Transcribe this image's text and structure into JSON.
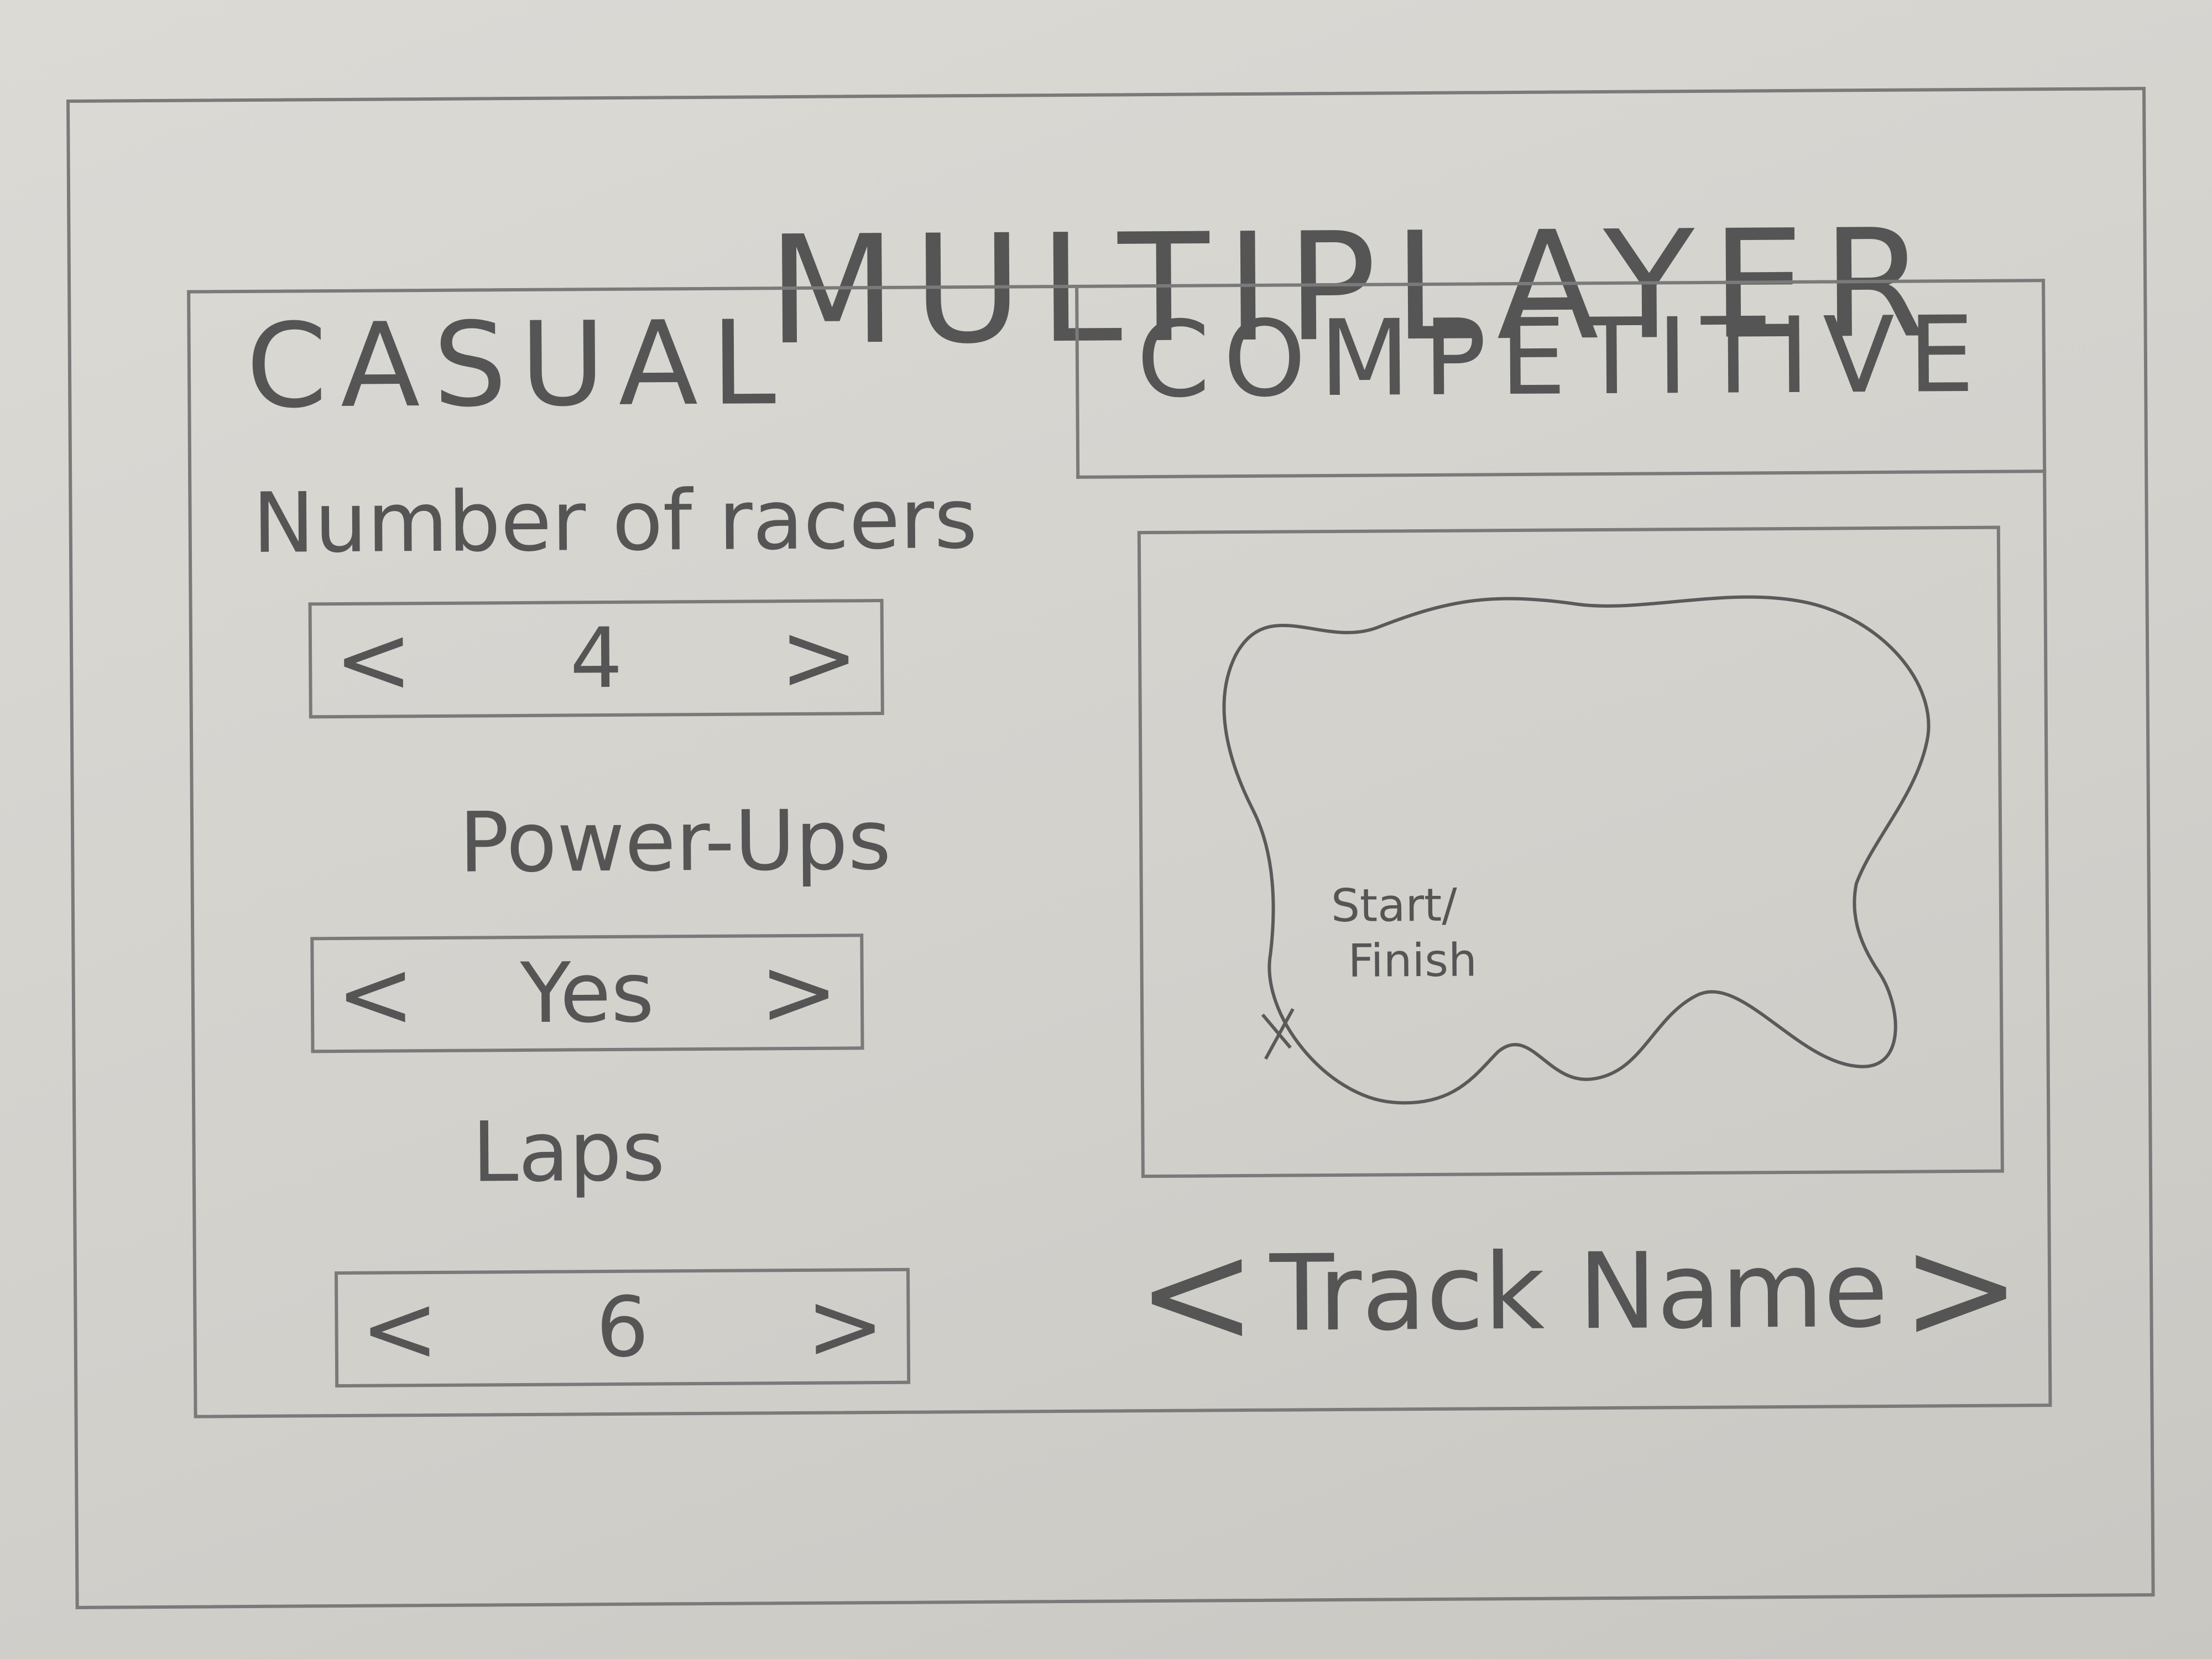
{
  "screen": {
    "title": "MULTIPLAYER"
  },
  "tabs": {
    "casual": "CASUAL",
    "competitive": "COMPETITIVE"
  },
  "settings": {
    "racers": {
      "label": "Number of racers",
      "value": "4"
    },
    "powerups": {
      "label": "Power-Ups",
      "value": "Yes"
    },
    "laps": {
      "label": "Laps",
      "value": "6"
    }
  },
  "track": {
    "start_finish_label_line1": "Start/",
    "start_finish_label_line2": "Finish",
    "name": "Track Name"
  },
  "icons": {
    "prev": "chevron-left-icon",
    "next": "chevron-right-icon",
    "start_marker": "x-marker-icon"
  },
  "colors": {
    "pencil": "#555555",
    "paper": "#d4d2cd"
  }
}
